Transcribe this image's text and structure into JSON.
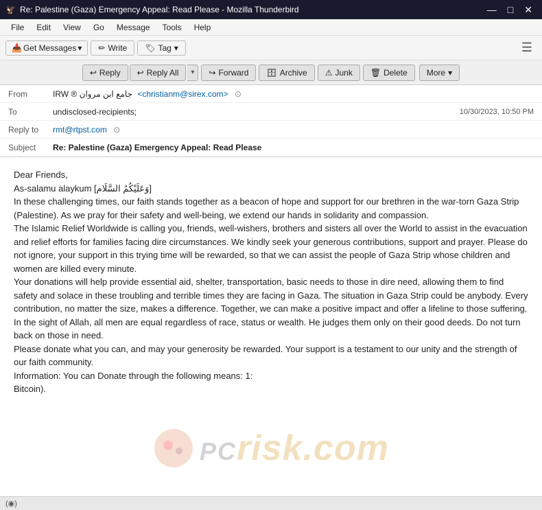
{
  "window": {
    "title": "Re: Palestine (Gaza) Emergency Appeal: Read Please - Mozilla Thunderbird",
    "icon": "🦅"
  },
  "titlebar": {
    "controls": {
      "minimize": "—",
      "maximize": "□",
      "close": "✕"
    }
  },
  "menubar": {
    "items": [
      "File",
      "Edit",
      "View",
      "Go",
      "Message",
      "Tools",
      "Help"
    ]
  },
  "toolbar": {
    "get_messages_label": "Get Messages",
    "write_label": "Write",
    "tag_label": "Tag",
    "hamburger": "☰"
  },
  "action_toolbar": {
    "reply_label": "Reply",
    "reply_all_label": "Reply All",
    "forward_label": "Forward",
    "archive_label": "Archive",
    "junk_label": "Junk",
    "delete_label": "Delete",
    "more_label": "More"
  },
  "email": {
    "from_label": "From",
    "from_name": "IRW ® جامع ابن مروان",
    "from_email": "<christianm@sirex.com>",
    "to_label": "To",
    "to_value": "undisclosed-recipients;",
    "date": "10/30/2023, 10:50 PM",
    "reply_to_label": "Reply to",
    "reply_to_value": "rmt@rtpst.com",
    "subject_label": "Subject",
    "subject_value": "Re: Palestine (Gaza) Emergency Appeal: Read Please",
    "body": {
      "greeting": "Dear Friends,",
      "salutation": "As-salamu alaykum [وَعَلَيْكُمُ السَّلَام]",
      "paragraph1": "In these challenging times, our faith stands together as a beacon of hope and support for our brethren in the war-torn Gaza Strip (Palestine). As we pray for their safety and well-being, we extend our hands in solidarity and compassion.",
      "paragraph2": "The Islamic Relief Worldwide is calling you, friends, well-wishers, brothers and sisters all over the World to assist in the evacuation and relief efforts for families facing dire circumstances. We kindly seek your generous contributions, support and prayer. Please do not ignore, your support in this trying time will be rewarded, so that we can assist the people of Gaza Strip whose children and women are killed every minute.",
      "paragraph3": "Your donations will help provide essential aid, shelter, transportation, basic needs to those in dire need, allowing them to find safety and solace in these troubling and terrible times they are facing in Gaza. The situation in Gaza Strip could be anybody. Every contribution, no matter the size, makes a difference. Together, we can make a positive impact and offer a lifeline to those suffering. In the sight of Allah, all men are equal regardless of race, status or wealth. He judges them only on their good deeds. Do not turn back on those in need.",
      "paragraph4": "Please donate what you can, and may your generosity be rewarded. Your support is a testament to our unity and the strength of our faith community.",
      "paragraph5": "Information: You can Donate through the following means: 1:",
      "paragraph6": "Bitcoin)."
    }
  },
  "watermark": {
    "text": "risk.com"
  },
  "status_bar": {
    "text": "(◉)"
  },
  "icons": {
    "reply": "↩",
    "forward": "↪",
    "archive": "🗄",
    "junk": "⚠",
    "delete": "🗑",
    "dropdown": "▾",
    "chevron_down": "▾",
    "pencil": "✏",
    "tag": "🏷",
    "get_messages": "📥",
    "verify": "⊙",
    "shield": "⊙"
  }
}
